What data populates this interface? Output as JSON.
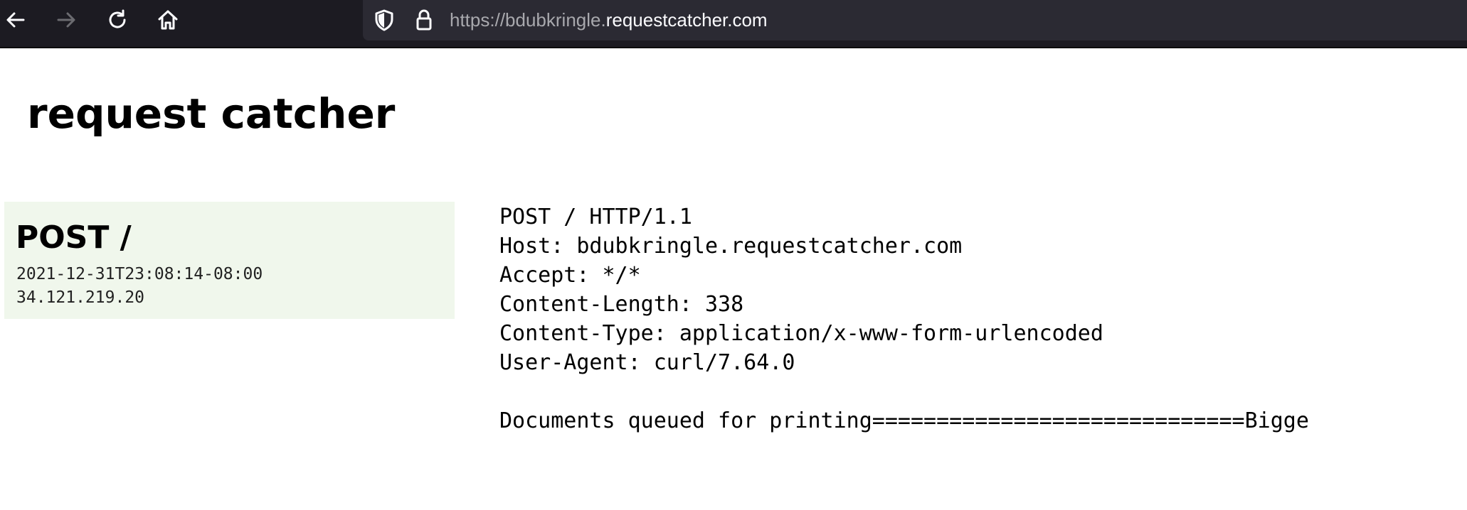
{
  "browser": {
    "url_prefix": "https://bdubkringle.",
    "url_domain": "requestcatcher.com",
    "icons": [
      "back-arrow",
      "forward-arrow",
      "reload",
      "home",
      "shield",
      "lock"
    ]
  },
  "page": {
    "title": "request catcher"
  },
  "request": {
    "summary": {
      "method_path": "POST /",
      "timestamp": "2021-12-31T23:08:14-08:00",
      "ip": "34.121.219.20"
    },
    "raw_lines": [
      "POST / HTTP/1.1",
      "Host: bdubkringle.requestcatcher.com",
      "Accept: */*",
      "Content-Length: 338",
      "Content-Type: application/x-www-form-urlencoded",
      "User-Agent: curl/7.64.0"
    ],
    "body": "Documents queued for printing=============================Bigge"
  },
  "colors": {
    "toolbar_bg": "#1c1b22",
    "urlbar_bg": "#2b2a33",
    "card_bg": "#f0f7ec"
  }
}
